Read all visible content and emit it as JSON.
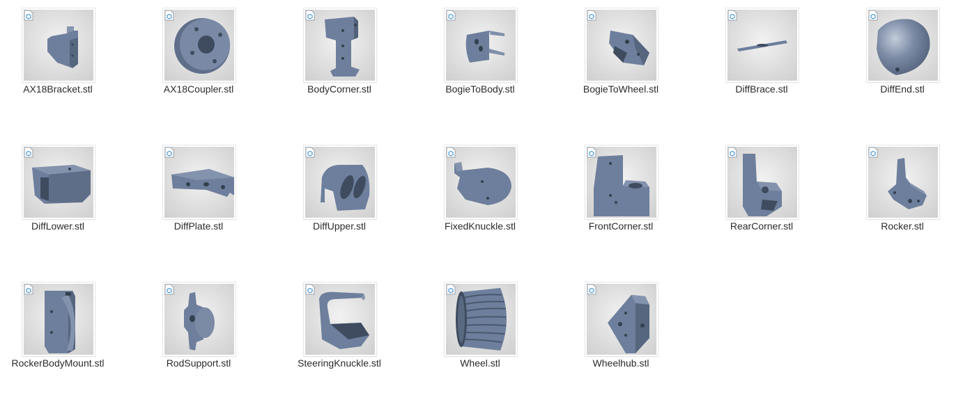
{
  "files": [
    {
      "name": "AX18Bracket.stl",
      "icon": "bracket-model-icon"
    },
    {
      "name": "AX18Coupler.stl",
      "icon": "coupler-model-icon"
    },
    {
      "name": "BodyCorner.stl",
      "icon": "body-corner-model-icon"
    },
    {
      "name": "BogieToBody.stl",
      "icon": "bogie-to-body-model-icon"
    },
    {
      "name": "BogieToWheel.stl",
      "icon": "bogie-to-wheel-model-icon"
    },
    {
      "name": "DiffBrace.stl",
      "icon": "diff-brace-model-icon"
    },
    {
      "name": "DiffEnd.stl",
      "icon": "diff-end-model-icon"
    },
    {
      "name": "DiffLower.stl",
      "icon": "diff-lower-model-icon"
    },
    {
      "name": "DiffPlate.stl",
      "icon": "diff-plate-model-icon"
    },
    {
      "name": "DiffUpper.stl",
      "icon": "diff-upper-model-icon"
    },
    {
      "name": "FixedKnuckle.stl",
      "icon": "fixed-knuckle-model-icon"
    },
    {
      "name": "FrontCorner.stl",
      "icon": "front-corner-model-icon"
    },
    {
      "name": "RearCorner.stl",
      "icon": "rear-corner-model-icon"
    },
    {
      "name": "Rocker.stl",
      "icon": "rocker-model-icon"
    },
    {
      "name": "RockerBodyMount.stl",
      "icon": "rocker-body-mount-model-icon"
    },
    {
      "name": "RodSupport.stl",
      "icon": "rod-support-model-icon"
    },
    {
      "name": "SteeringKnuckle.stl",
      "icon": "steering-knuckle-model-icon"
    },
    {
      "name": "Wheel.stl",
      "icon": "wheel-model-icon"
    },
    {
      "name": "Wheelhub.stl",
      "icon": "wheelhub-model-icon"
    }
  ],
  "file_type_badge_icon": "3d-object-file-icon",
  "model_color": "#6d7f9c"
}
